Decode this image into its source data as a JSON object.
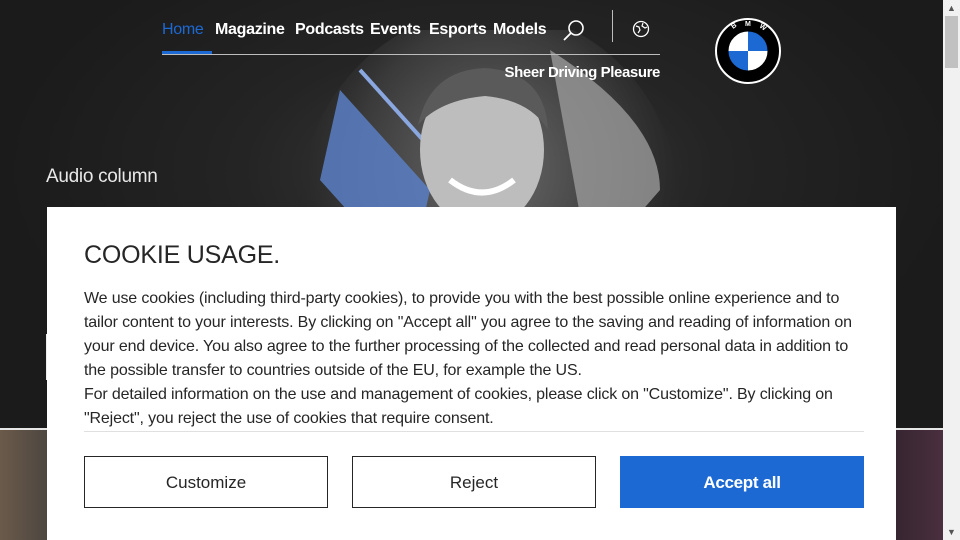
{
  "nav": {
    "items": [
      {
        "label": "Home",
        "active": true
      },
      {
        "label": "Magazine"
      },
      {
        "label": "Podcasts"
      },
      {
        "label": "Events"
      },
      {
        "label": "Esports"
      },
      {
        "label": "Models"
      }
    ],
    "search_icon": "search-icon",
    "language_icon": "globe-icon",
    "tagline": "Sheer Driving Pleasure"
  },
  "brand": {
    "logo_letters": "BMW",
    "accent_color": "#1c69d4"
  },
  "hero": {
    "eyebrow": "Audio column"
  },
  "cookie": {
    "title": "COOKIE USAGE.",
    "paragraph": "We use cookies (including third-party cookies), to provide you with the best possible online experience and to tailor content to your interests. By clicking on \"Accept all\" you agree to the saving and reading of information on your end device. You also agree to the further processing of the collected and read personal data in addition to the possible transfer to countries outside of the EU, for example the US.",
    "paragraph2": "For detailed information on the use and management of cookies, please click on \"Customize\". By clicking on \"Reject\", you reject the use of cookies that require consent.",
    "customize_label": "Customize",
    "reject_label": "Reject",
    "accept_label": "Accept all"
  }
}
